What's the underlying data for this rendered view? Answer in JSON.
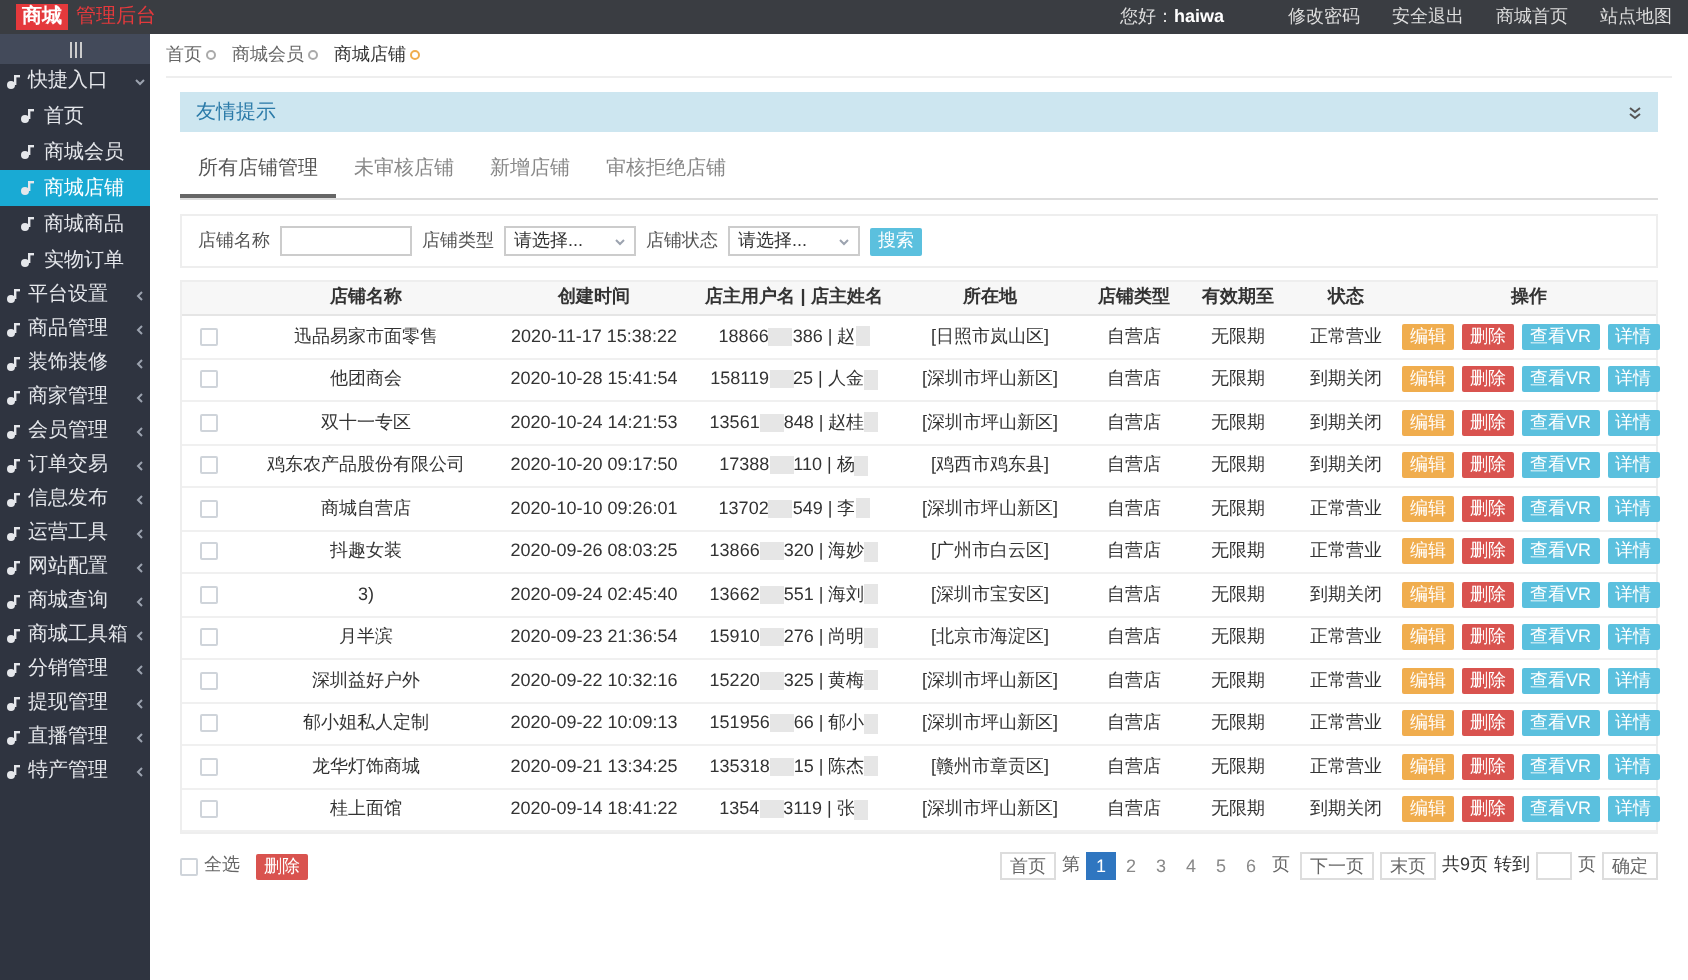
{
  "header": {
    "logo": "商城",
    "title": "管理后台",
    "greeting": "您好：",
    "user": "haiwa",
    "links": [
      "修改密码",
      "安全退出",
      "商城首页",
      "站点地图"
    ]
  },
  "sidebar": {
    "items": [
      {
        "label": "快捷入口",
        "expanded": true,
        "selected": false,
        "children": [
          {
            "label": "首页",
            "selected": false
          },
          {
            "label": "商城会员",
            "selected": false
          },
          {
            "label": "商城店铺",
            "selected": true
          },
          {
            "label": "商城商品",
            "selected": false
          },
          {
            "label": "实物订单",
            "selected": false
          }
        ]
      },
      {
        "label": "平台设置",
        "expanded": false,
        "selected": false
      },
      {
        "label": "商品管理",
        "expanded": false,
        "selected": false
      },
      {
        "label": "装饰装修",
        "expanded": false,
        "selected": false
      },
      {
        "label": "商家管理",
        "expanded": false,
        "selected": false
      },
      {
        "label": "会员管理",
        "expanded": false,
        "selected": false
      },
      {
        "label": "订单交易",
        "expanded": false,
        "selected": false
      },
      {
        "label": "信息发布",
        "expanded": false,
        "selected": false
      },
      {
        "label": "运营工具",
        "expanded": false,
        "selected": false
      },
      {
        "label": "网站配置",
        "expanded": false,
        "selected": false
      },
      {
        "label": "商城查询",
        "expanded": false,
        "selected": false
      },
      {
        "label": "商城工具箱",
        "expanded": false,
        "selected": false
      },
      {
        "label": "分销管理",
        "expanded": false,
        "selected": false
      },
      {
        "label": "提现管理",
        "expanded": false,
        "selected": false
      },
      {
        "label": "直播管理",
        "expanded": false,
        "selected": false
      },
      {
        "label": "特产管理",
        "expanded": false,
        "selected": false
      }
    ]
  },
  "breadcrumb": [
    {
      "label": "首页",
      "selected": false
    },
    {
      "label": "商城会员",
      "selected": false
    },
    {
      "label": "商城店铺",
      "selected": true
    }
  ],
  "notice": {
    "title": "友情提示"
  },
  "tabs": [
    {
      "label": "所有店铺管理",
      "selected": true
    },
    {
      "label": "未审核店铺",
      "selected": false
    },
    {
      "label": "新增店铺",
      "selected": false
    },
    {
      "label": "审核拒绝店铺",
      "selected": false
    }
  ],
  "filters": {
    "name_label": "店铺名称",
    "type_label": "店铺类型",
    "type_value": "请选择...",
    "status_label": "店铺状态",
    "status_value": "请选择...",
    "search": "搜索"
  },
  "table": {
    "columns": [
      "店铺名称",
      "创建时间",
      "店主用户名 | 店主姓名",
      "所在地",
      "店铺类型",
      "有效期至",
      "状态",
      "操作"
    ],
    "rows": [
      {
        "checked": false,
        "name": "迅品易家市面零售",
        "created": "2020-11-17 15:38:22",
        "owner_start": "18866",
        "owner_end": "386 | 赵",
        "location": "[日照市岚山区]",
        "type": "自营店",
        "expiry": "无限期",
        "status": "正常营业",
        "actions": [
          {
            "label": "编辑",
            "kind": "edit"
          },
          {
            "label": "删除",
            "kind": "delete"
          },
          {
            "label": "查看VR",
            "kind": "info"
          },
          {
            "label": "详情",
            "kind": "info"
          }
        ]
      },
      {
        "checked": false,
        "name": "他团商会",
        "created": "2020-10-28 15:41:54",
        "owner_start": "158119",
        "owner_end": "25 | 人金",
        "location": "[深圳市坪山新区]",
        "type": "自营店",
        "expiry": "无限期",
        "status": "到期关闭",
        "actions": [
          {
            "label": "编辑",
            "kind": "edit"
          },
          {
            "label": "删除",
            "kind": "delete"
          },
          {
            "label": "查看VR",
            "kind": "info"
          },
          {
            "label": "详情",
            "kind": "info"
          }
        ]
      },
      {
        "checked": false,
        "name": "双十一专区",
        "created": "2020-10-24 14:21:53",
        "owner_start": "13561",
        "owner_end": "848 | 赵桂",
        "location": "[深圳市坪山新区]",
        "type": "自营店",
        "expiry": "无限期",
        "status": "到期关闭",
        "actions": [
          {
            "label": "编辑",
            "kind": "edit"
          },
          {
            "label": "删除",
            "kind": "delete"
          },
          {
            "label": "查看VR",
            "kind": "info"
          },
          {
            "label": "详情",
            "kind": "info"
          }
        ]
      },
      {
        "checked": false,
        "name": "鸡东农产品股份有限公司",
        "created": "2020-10-20 09:17:50",
        "owner_start": "17388",
        "owner_end": "110 | 杨",
        "location": "[鸡西市鸡东县]",
        "type": "自营店",
        "expiry": "无限期",
        "status": "到期关闭",
        "actions": [
          {
            "label": "编辑",
            "kind": "edit"
          },
          {
            "label": "删除",
            "kind": "delete"
          },
          {
            "label": "查看VR",
            "kind": "info"
          },
          {
            "label": "详情",
            "kind": "info"
          }
        ]
      },
      {
        "checked": false,
        "name": "商城自营店",
        "created": "2020-10-10 09:26:01",
        "owner_start": "13702",
        "owner_end": "549 | 李",
        "location": "[深圳市坪山新区]",
        "type": "自营店",
        "expiry": "无限期",
        "status": "正常营业",
        "actions": [
          {
            "label": "编辑",
            "kind": "edit"
          },
          {
            "label": "删除",
            "kind": "delete"
          },
          {
            "label": "查看VR",
            "kind": "info"
          },
          {
            "label": "详情",
            "kind": "info"
          }
        ]
      },
      {
        "checked": false,
        "name": "抖趣女装",
        "created": "2020-09-26 08:03:25",
        "owner_start": "13866",
        "owner_end": "320 | 海妙",
        "location": "[广州市白云区]",
        "type": "自营店",
        "expiry": "无限期",
        "status": "正常营业",
        "actions": [
          {
            "label": "编辑",
            "kind": "edit"
          },
          {
            "label": "删除",
            "kind": "delete"
          },
          {
            "label": "查看VR",
            "kind": "info"
          },
          {
            "label": "详情",
            "kind": "info"
          }
        ]
      },
      {
        "checked": false,
        "name": "3)",
        "created": "2020-09-24 02:45:40",
        "owner_start": "13662",
        "owner_end": "551 | 海刘",
        "location": "[深圳市宝安区]",
        "type": "自营店",
        "expiry": "无限期",
        "status": "到期关闭",
        "actions": [
          {
            "label": "编辑",
            "kind": "edit"
          },
          {
            "label": "删除",
            "kind": "delete"
          },
          {
            "label": "查看VR",
            "kind": "info"
          },
          {
            "label": "详情",
            "kind": "info"
          }
        ]
      },
      {
        "checked": false,
        "name": "月半滨",
        "created": "2020-09-23 21:36:54",
        "owner_start": "15910",
        "owner_end": "276 | 尚明",
        "location": "[北京市海淀区]",
        "type": "自营店",
        "expiry": "无限期",
        "status": "正常营业",
        "actions": [
          {
            "label": "编辑",
            "kind": "edit"
          },
          {
            "label": "删除",
            "kind": "delete"
          },
          {
            "label": "查看VR",
            "kind": "info"
          },
          {
            "label": "详情",
            "kind": "info"
          }
        ]
      },
      {
        "checked": false,
        "name": "深圳益好户外",
        "created": "2020-09-22 10:32:16",
        "owner_start": "15220",
        "owner_end": "325 | 黄梅",
        "location": "[深圳市坪山新区]",
        "type": "自营店",
        "expiry": "无限期",
        "status": "正常营业",
        "actions": [
          {
            "label": "编辑",
            "kind": "edit"
          },
          {
            "label": "删除",
            "kind": "delete"
          },
          {
            "label": "查看VR",
            "kind": "info"
          },
          {
            "label": "详情",
            "kind": "info"
          }
        ]
      },
      {
        "checked": false,
        "name": "郁小姐私人定制",
        "created": "2020-09-22 10:09:13",
        "owner_start": "151956",
        "owner_end": "66 | 郁小",
        "location": "[深圳市坪山新区]",
        "type": "自营店",
        "expiry": "无限期",
        "status": "正常营业",
        "actions": [
          {
            "label": "编辑",
            "kind": "edit"
          },
          {
            "label": "删除",
            "kind": "delete"
          },
          {
            "label": "查看VR",
            "kind": "info"
          },
          {
            "label": "详情",
            "kind": "info"
          }
        ]
      },
      {
        "checked": false,
        "name": "龙华灯饰商城",
        "created": "2020-09-21 13:34:25",
        "owner_start": "135318",
        "owner_end": "15 | 陈杰",
        "location": "[赣州市章贡区]",
        "type": "自营店",
        "expiry": "无限期",
        "status": "正常营业",
        "actions": [
          {
            "label": "编辑",
            "kind": "edit"
          },
          {
            "label": "删除",
            "kind": "delete"
          },
          {
            "label": "查看VR",
            "kind": "info"
          },
          {
            "label": "详情",
            "kind": "info"
          }
        ]
      },
      {
        "checked": false,
        "name": "桂上面馆",
        "created": "2020-09-14 18:41:22",
        "owner_start": "1354",
        "owner_end": "3119 | 张",
        "location": "[深圳市坪山新区]",
        "type": "自营店",
        "expiry": "无限期",
        "status": "到期关闭",
        "actions": [
          {
            "label": "编辑",
            "kind": "edit"
          },
          {
            "label": "删除",
            "kind": "delete"
          },
          {
            "label": "查看VR",
            "kind": "info"
          },
          {
            "label": "详情",
            "kind": "info"
          }
        ]
      }
    ]
  },
  "footer": {
    "select_all": "全选",
    "select_all_checked": false,
    "delete": "删除"
  },
  "pagination": {
    "first": "首页",
    "prefix": "第",
    "pages": [
      {
        "label": "1",
        "selected": true
      },
      {
        "label": "2",
        "selected": false
      },
      {
        "label": "3",
        "selected": false
      },
      {
        "label": "4",
        "selected": false
      },
      {
        "label": "5",
        "selected": false
      },
      {
        "label": "6",
        "selected": false
      }
    ],
    "suffix": "页",
    "next": "下一页",
    "last": "末页",
    "total": "共9页",
    "goto": "转到",
    "goto_suffix": "页",
    "confirm": "确定"
  }
}
